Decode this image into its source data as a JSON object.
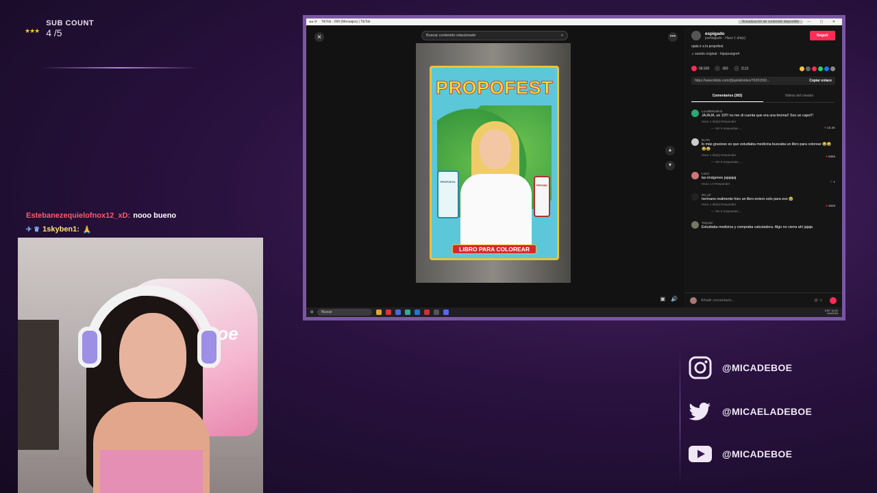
{
  "overlay": {
    "subcount_label": "SUB COUNT",
    "subcount_value": "4 /5",
    "subcount_stars": "★★★"
  },
  "chat": [
    {
      "user": "Estebanezequielofnox12_xD:",
      "message": "nooo bueno"
    },
    {
      "user": "1skyben1:",
      "message": ""
    }
  ],
  "browser": {
    "tab_title": "TikTok - 099 (Mensajes) | TikTok",
    "notice": "Actualización de contenido disponible",
    "window_controls": "— ▢ ✕"
  },
  "tiktok": {
    "search_placeholder": "Buscar contenido relacionado",
    "close_glyph": "✕",
    "more_glyph": "•••",
    "cover": {
      "title": "PROPOFEST",
      "banner": "LIBRO PARA COLOREAR",
      "vial_left": "PROPOFOL",
      "vial_right": "FENTANIL"
    },
    "author": {
      "name": "espigado",
      "handle_time": "puntiagudo · Hace 1 día(s)",
      "follow_label": "Seguir"
    },
    "description": "ojala ir a la propofest",
    "sound": "♫ sonido original - hipoposigm4",
    "stats": {
      "likes": "58.500",
      "comments": "383",
      "saves": "2113"
    },
    "link": "https://www.tiktok.com/@spikiii/video/76261593...",
    "copy_link_label": "Copiar enlace",
    "tabs": [
      "Comentarios (383)",
      "Videos del creador"
    ],
    "comments": [
      {
        "user": "Local59Galeria",
        "text": "JAJAJA, un 10!!! no me di cuenta que era una broma!! Sos un capo!!!",
        "meta": "Hace 1 día(s)   Responder",
        "likes": "10.2K",
        "replies": "— Ver 5 respuestas ⌄"
      },
      {
        "user": "ELITA",
        "text": "lo más gracioso es que estudiaba medicina buscaba un libro para colorear 😂😂😂😂",
        "meta": "Hace 1 día(s)   Responder",
        "likes": "5866",
        "replies": "— Ver 8 respuestas ⌄"
      },
      {
        "user": "Lumii",
        "text": "las imágenes jajajajaj",
        "meta": "Hace 1 h   Responder",
        "likes": "1",
        "replies": ""
      },
      {
        "user": "ian_jol",
        "text": "hermano realmente hizo un libro entero solo para eso 😭",
        "meta": "Hace 1 día(s)   Responder",
        "likes": "2929",
        "replies": "— Ver 5 respuestas ⌄"
      },
      {
        "user": "TonyVal",
        "text": "Estudiaba medicina y compraba calculadora. Algo no cierra ahí jajaja",
        "meta": "",
        "likes": "",
        "replies": ""
      }
    ],
    "add_comment_placeholder": "Añadir comentario..."
  },
  "taskbar": {
    "search": "Buscar",
    "time": "16:52",
    "date": "8/4/2025",
    "lang": "ESP"
  },
  "socials": {
    "instagram": "@MICADEBOE",
    "twitter": "@MICAELADEBOE",
    "youtube": "@MICADEBOE"
  },
  "colors": {
    "accent_pink": "#fe2c55",
    "frame_purple": "#7a57a1",
    "chat_user1": "#ff5a6a",
    "chat_user2": "#ffe07a"
  }
}
